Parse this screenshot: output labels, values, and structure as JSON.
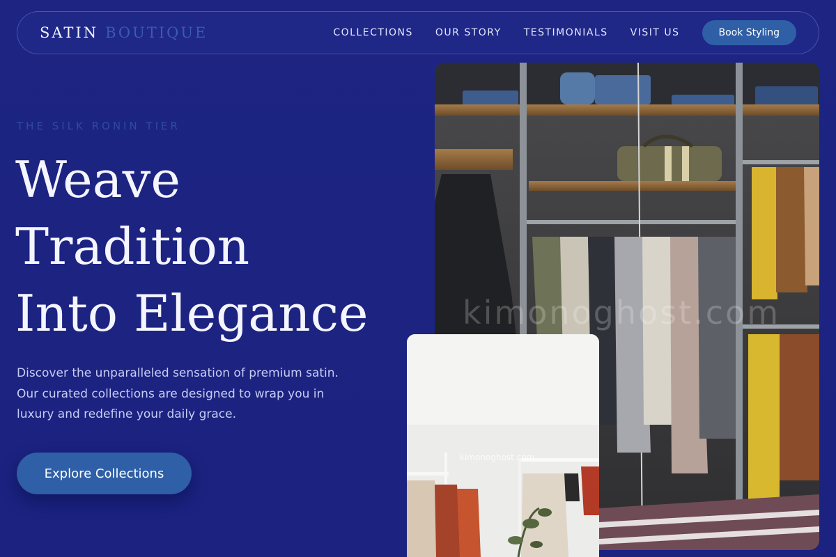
{
  "brand": {
    "name_primary": "SATIN",
    "name_secondary": "BOUTIQUE"
  },
  "nav": {
    "links": [
      "COLLECTIONS",
      "OUR STORY",
      "TESTIMONIALS",
      "VISIT US"
    ],
    "cta_label": "Book Styling"
  },
  "hero": {
    "eyebrow": "THE SILK RONIN TIER",
    "headline_lines": [
      "Weave",
      "Tradition",
      "Into Elegance"
    ],
    "description": "Discover the unparalleled sensation of premium satin. Our curated collections are designed to wrap you in luxury and redefine your daily grace.",
    "cta_label": "Explore Collections"
  },
  "images": {
    "main_watermark": "kimonoghost.com",
    "secondary_watermark": "kimonoghost.com"
  },
  "colors": {
    "background": "#1c2380",
    "accent": "#2f5fa6",
    "eyebrow": "#2d4c9e",
    "brand_secondary": "#3b5bb0"
  }
}
